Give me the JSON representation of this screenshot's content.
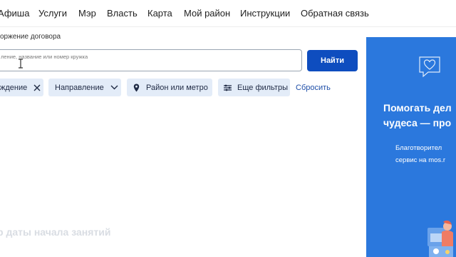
{
  "nav": {
    "items": [
      "Афиша",
      "Услуги",
      "Мэр",
      "Власть",
      "Карта",
      "Мой район",
      "Инструкции",
      "Обратная связь"
    ]
  },
  "filters": {
    "subtitle": "оржение договора",
    "search_placeholder": "ление, название или номер кружка",
    "find_label": "Найти",
    "chip_selected_label": "ждение",
    "chip_direction_label": "Направление",
    "chip_region_label": "Район или метро",
    "chip_more_label": "Еще фильтры",
    "reset_label": "Сбросить"
  },
  "results": {
    "sort_hint": "р даты начала занятий"
  },
  "banner": {
    "title": "Помогать дел\nчудеса — про",
    "description": "Благотворител\nсервис на mos.r",
    "background": "#2b78dd"
  },
  "colors": {
    "accent": "#0e4dbf",
    "chip_bg": "#e3ecf8"
  }
}
